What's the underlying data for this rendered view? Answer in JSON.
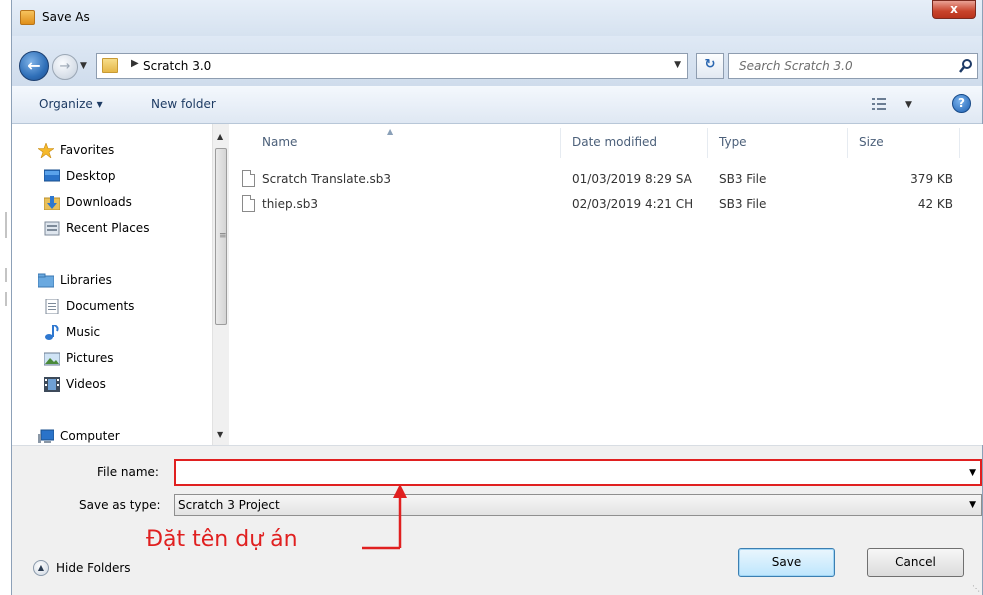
{
  "window": {
    "title": "Save As",
    "close_glyph": "x"
  },
  "address": {
    "crumb": "Scratch 3.0",
    "search_placeholder": "Search Scratch 3.0"
  },
  "toolbar": {
    "organize": "Organize ▾",
    "new_folder": "New folder"
  },
  "nav": {
    "items": [
      {
        "label": "Favorites",
        "icon": "star-icon"
      },
      {
        "label": "Desktop",
        "icon": "desktop-icon"
      },
      {
        "label": "Downloads",
        "icon": "downloads-icon"
      },
      {
        "label": "Recent Places",
        "icon": "recent-places-icon"
      },
      {
        "label": "Libraries",
        "icon": "libraries-icon"
      },
      {
        "label": "Documents",
        "icon": "documents-icon"
      },
      {
        "label": "Music",
        "icon": "music-icon"
      },
      {
        "label": "Pictures",
        "icon": "pictures-icon"
      },
      {
        "label": "Videos",
        "icon": "videos-icon"
      },
      {
        "label": "Computer",
        "icon": "computer-icon"
      }
    ]
  },
  "files": {
    "columns": [
      "Name",
      "Date modified",
      "Type",
      "Size"
    ],
    "rows": [
      {
        "name": "Scratch Translate.sb3",
        "date": "01/03/2019 8:29 SA",
        "type": "SB3 File",
        "size": "379 KB"
      },
      {
        "name": "thiep.sb3",
        "date": "02/03/2019 4:21 CH",
        "type": "SB3 File",
        "size": "42 KB"
      }
    ]
  },
  "form": {
    "file_name_label": "File name:",
    "file_name_value": "",
    "save_type_label": "Save as type:",
    "save_type_value": "Scratch 3 Project"
  },
  "annotation": {
    "text": "Đặt tên dự án",
    "color": "#e02020"
  },
  "footer": {
    "hide_folders": "Hide Folders",
    "save": "Save",
    "cancel": "Cancel"
  }
}
